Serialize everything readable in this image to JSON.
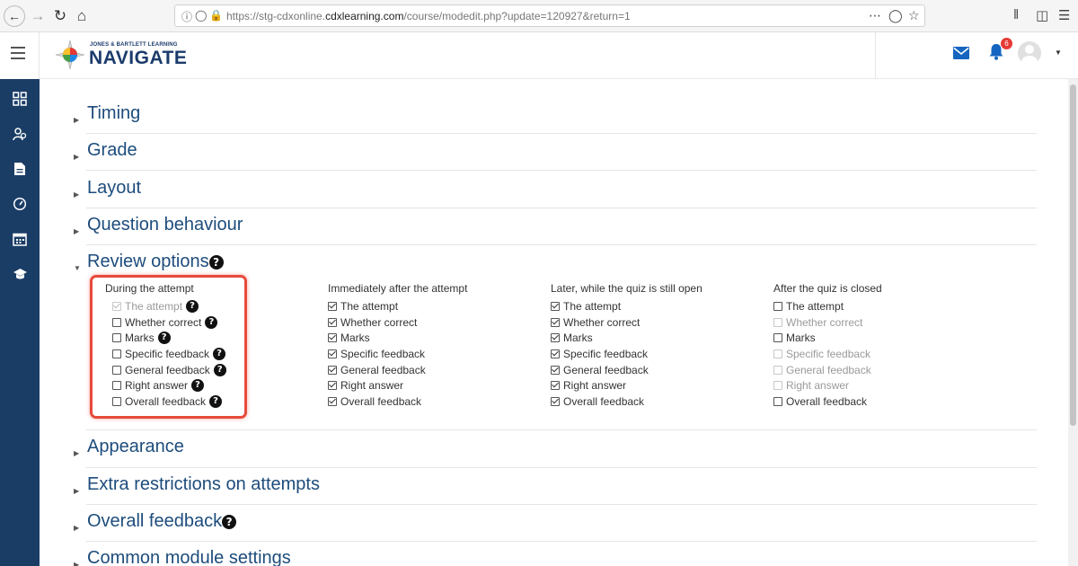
{
  "browser": {
    "url_prefix": "https://stg-cdxonline.",
    "url_domain": "cdxlearning.com",
    "url_path": "/course/modedit.php?update=120927&return=1"
  },
  "header": {
    "logo_small": "JONES & BARTLETT LEARNING",
    "logo_big": "NAVIGATE",
    "notification_count": "6"
  },
  "sections": [
    {
      "label": "Timing",
      "expanded": false,
      "help": false
    },
    {
      "label": "Grade",
      "expanded": false,
      "help": false
    },
    {
      "label": "Layout",
      "expanded": false,
      "help": false
    },
    {
      "label": "Question behaviour",
      "expanded": false,
      "help": false
    },
    {
      "label": "Review options",
      "expanded": true,
      "help": true
    },
    {
      "label": "Appearance",
      "expanded": false,
      "help": false
    },
    {
      "label": "Extra restrictions on attempts",
      "expanded": false,
      "help": false
    },
    {
      "label": "Overall feedback",
      "expanded": false,
      "help": true
    },
    {
      "label": "Common module settings",
      "expanded": false,
      "help": false
    }
  ],
  "review_options": {
    "columns": [
      {
        "heading": "During the attempt",
        "options": [
          {
            "label": "The attempt",
            "checked": true,
            "disabled": true,
            "help": true
          },
          {
            "label": "Whether correct",
            "checked": false,
            "disabled": false,
            "help": true
          },
          {
            "label": "Marks",
            "checked": false,
            "disabled": false,
            "help": true
          },
          {
            "label": "Specific feedback",
            "checked": false,
            "disabled": false,
            "help": true
          },
          {
            "label": "General feedback",
            "checked": false,
            "disabled": false,
            "help": true
          },
          {
            "label": "Right answer",
            "checked": false,
            "disabled": false,
            "help": true
          },
          {
            "label": "Overall feedback",
            "checked": false,
            "disabled": false,
            "help": true
          }
        ]
      },
      {
        "heading": "Immediately after the attempt",
        "options": [
          {
            "label": "The attempt",
            "checked": true,
            "disabled": false
          },
          {
            "label": "Whether correct",
            "checked": true,
            "disabled": false
          },
          {
            "label": "Marks",
            "checked": true,
            "disabled": false
          },
          {
            "label": "Specific feedback",
            "checked": true,
            "disabled": false
          },
          {
            "label": "General feedback",
            "checked": true,
            "disabled": false
          },
          {
            "label": "Right answer",
            "checked": true,
            "disabled": false
          },
          {
            "label": "Overall feedback",
            "checked": true,
            "disabled": false
          }
        ]
      },
      {
        "heading": "Later, while the quiz is still open",
        "options": [
          {
            "label": "The attempt",
            "checked": true,
            "disabled": false
          },
          {
            "label": "Whether correct",
            "checked": true,
            "disabled": false
          },
          {
            "label": "Marks",
            "checked": true,
            "disabled": false
          },
          {
            "label": "Specific feedback",
            "checked": true,
            "disabled": false
          },
          {
            "label": "General feedback",
            "checked": true,
            "disabled": false
          },
          {
            "label": "Right answer",
            "checked": true,
            "disabled": false
          },
          {
            "label": "Overall feedback",
            "checked": true,
            "disabled": false
          }
        ]
      },
      {
        "heading": "After the quiz is closed",
        "options": [
          {
            "label": "The attempt",
            "checked": false,
            "disabled": false
          },
          {
            "label": "Whether correct",
            "checked": false,
            "disabled": true
          },
          {
            "label": "Marks",
            "checked": false,
            "disabled": false
          },
          {
            "label": "Specific feedback",
            "checked": false,
            "disabled": true
          },
          {
            "label": "General feedback",
            "checked": false,
            "disabled": true
          },
          {
            "label": "Right answer",
            "checked": false,
            "disabled": true
          },
          {
            "label": "Overall feedback",
            "checked": false,
            "disabled": false
          }
        ]
      }
    ]
  },
  "colors": {
    "sidebar": "#1a3d66",
    "section_title": "#1d4c7c",
    "highlight": "#e74a3b",
    "brand_blue": "#1565c0"
  }
}
